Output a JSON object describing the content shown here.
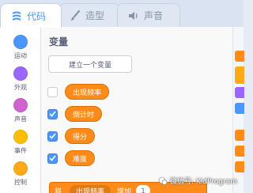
{
  "tabs": [
    {
      "label": "代码",
      "icon": "code-icon",
      "active": true
    },
    {
      "label": "造型",
      "icon": "brush-icon",
      "active": false
    },
    {
      "label": "声音",
      "icon": "speaker-icon",
      "active": false
    }
  ],
  "categories": [
    {
      "label": "运动",
      "color": "#4c97ff"
    },
    {
      "label": "外观",
      "color": "#9966ff"
    },
    {
      "label": "声音",
      "color": "#cf63cf"
    },
    {
      "label": "事件",
      "color": "#ffbf00"
    },
    {
      "label": "控制",
      "color": "#ffab19"
    }
  ],
  "palette": {
    "title": "变量",
    "make_variable_label": "建立一个变量",
    "variables": [
      {
        "name": "出现频率",
        "checked": false
      },
      {
        "name": "倒计时",
        "checked": true
      },
      {
        "name": "得分",
        "checked": true
      },
      {
        "name": "难度",
        "checked": true
      }
    ],
    "bottom_block": {
      "prefix": "将",
      "variable": "出现频率",
      "middle": "增加",
      "value": "1"
    }
  },
  "script_area": {
    "block_colors": [
      "#ff8c1a",
      "#ffab19",
      "#9966ff",
      "#4c97ff",
      "#ff8c1a",
      "#ff8c1a",
      "#ff8c1a"
    ]
  },
  "watermark": {
    "text": "微信号: KidProgram"
  }
}
